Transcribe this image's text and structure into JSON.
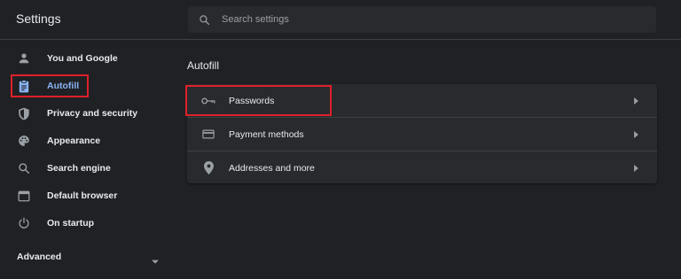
{
  "app": {
    "title": "Settings"
  },
  "search": {
    "placeholder": "Search settings"
  },
  "sidebar": {
    "items": [
      {
        "label": "You and Google",
        "icon": "person-icon"
      },
      {
        "label": "Autofill",
        "icon": "clipboard-icon",
        "active": true
      },
      {
        "label": "Privacy and security",
        "icon": "shield-icon"
      },
      {
        "label": "Appearance",
        "icon": "palette-icon"
      },
      {
        "label": "Search engine",
        "icon": "search-icon"
      },
      {
        "label": "Default browser",
        "icon": "browser-window-icon"
      },
      {
        "label": "On startup",
        "icon": "power-icon"
      }
    ],
    "advanced_label": "Advanced"
  },
  "main": {
    "section_title": "Autofill",
    "rows": [
      {
        "label": "Passwords",
        "icon": "key-icon"
      },
      {
        "label": "Payment methods",
        "icon": "credit-card-icon"
      },
      {
        "label": "Addresses and more",
        "icon": "location-pin-icon"
      }
    ]
  },
  "colors": {
    "background": "#202124",
    "card": "#292a2d",
    "accent": "#8ab4f8",
    "highlight_box": "#e0202a",
    "icon": "#9aa0a6",
    "text": "#e8eaed"
  }
}
